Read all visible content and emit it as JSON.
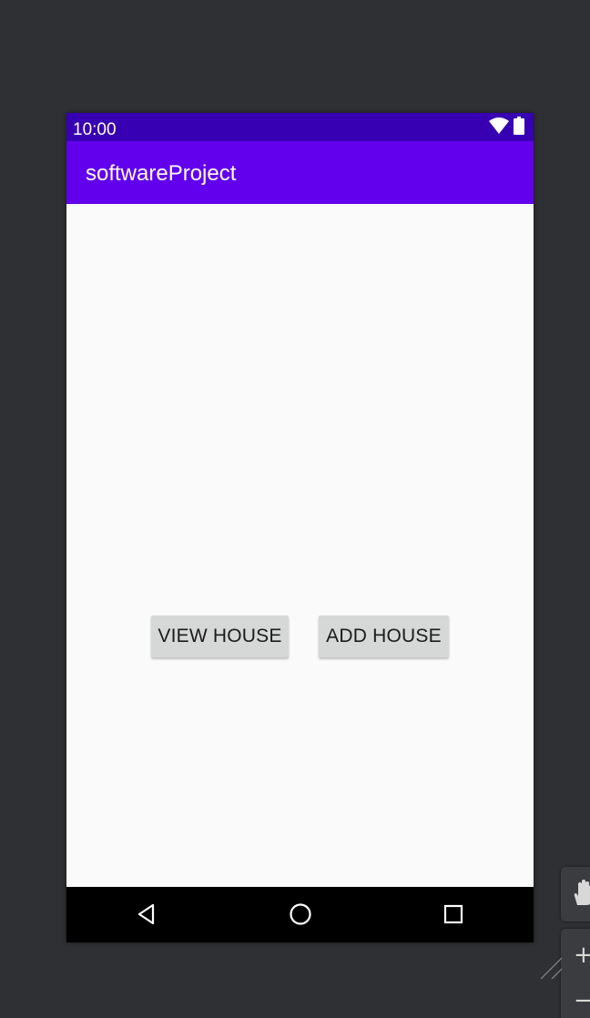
{
  "status_bar": {
    "time": "10:00",
    "icons": [
      "wifi-icon",
      "battery-icon"
    ]
  },
  "app_bar": {
    "title": "softwareProject"
  },
  "main": {
    "buttons": [
      {
        "label": "VIEW HOUSE"
      },
      {
        "label": "ADD HOUSE"
      }
    ]
  },
  "nav_bar": {
    "icons": [
      "back-icon",
      "home-icon",
      "recents-icon"
    ]
  },
  "tools": {
    "pan_icon": "hand-icon",
    "zoom_in_glyph": "+",
    "zoom_out_glyph": "−"
  },
  "colors": {
    "status_bar": "#3700b3",
    "app_bar": "#6200ee",
    "background": "#fafafa",
    "button": "#d6d7d7",
    "workspace": "#2f3033"
  }
}
